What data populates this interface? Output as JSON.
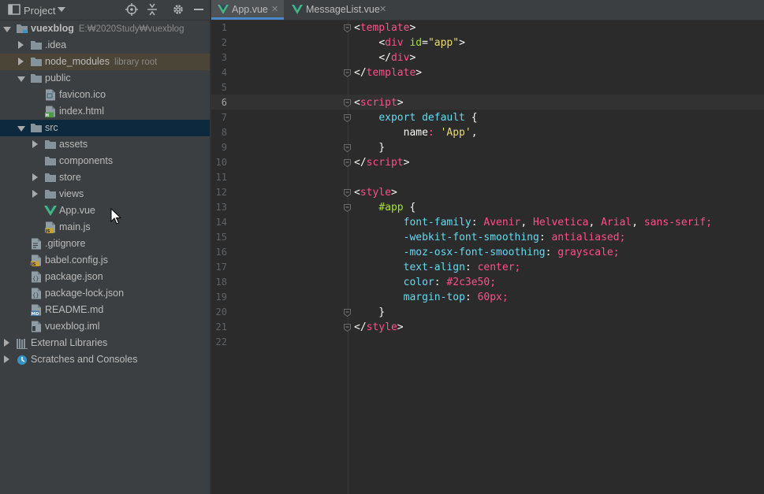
{
  "sidebar": {
    "title": "Project",
    "tree": [
      {
        "label": "vuexblog",
        "hint": "E:₩2020Study₩vuexblog",
        "icon": "module-folder-icon",
        "indent": 0,
        "arrow": "down",
        "bold": true
      },
      {
        "label": ".idea",
        "hint": "",
        "icon": "folder-icon",
        "indent": 1,
        "arrow": "right"
      },
      {
        "label": "node_modules",
        "hint": "library root",
        "icon": "folder-icon",
        "indent": 1,
        "arrow": "right",
        "state": "library"
      },
      {
        "label": "public",
        "hint": "",
        "icon": "folder-icon",
        "indent": 1,
        "arrow": "down"
      },
      {
        "label": "favicon.ico",
        "hint": "",
        "icon": "image-file-icon",
        "indent": 2,
        "arrow": "none"
      },
      {
        "label": "index.html",
        "hint": "",
        "icon": "html-file-icon",
        "indent": 2,
        "arrow": "none"
      },
      {
        "label": "src",
        "hint": "",
        "icon": "folder-icon",
        "indent": 1,
        "arrow": "down",
        "state": "selected"
      },
      {
        "label": "assets",
        "hint": "",
        "icon": "folder-icon",
        "indent": 2,
        "arrow": "right"
      },
      {
        "label": "components",
        "hint": "",
        "icon": "folder-icon",
        "indent": 2,
        "arrow": "none"
      },
      {
        "label": "store",
        "hint": "",
        "icon": "folder-icon",
        "indent": 2,
        "arrow": "right"
      },
      {
        "label": "views",
        "hint": "",
        "icon": "folder-icon",
        "indent": 2,
        "arrow": "right"
      },
      {
        "label": "App.vue",
        "hint": "",
        "icon": "vue-file-icon",
        "indent": 2,
        "arrow": "none"
      },
      {
        "label": "main.js",
        "hint": "",
        "icon": "js-file-icon",
        "indent": 2,
        "arrow": "none"
      },
      {
        "label": ".gitignore",
        "hint": "",
        "icon": "text-file-icon",
        "indent": 1,
        "arrow": "none"
      },
      {
        "label": "babel.config.js",
        "hint": "",
        "icon": "js-file-icon",
        "indent": 1,
        "arrow": "none"
      },
      {
        "label": "package.json",
        "hint": "",
        "icon": "json-file-icon",
        "indent": 1,
        "arrow": "none"
      },
      {
        "label": "package-lock.json",
        "hint": "",
        "icon": "json-file-icon",
        "indent": 1,
        "arrow": "none"
      },
      {
        "label": "README.md",
        "hint": "",
        "icon": "markdown-file-icon",
        "indent": 1,
        "arrow": "none"
      },
      {
        "label": "vuexblog.iml",
        "hint": "",
        "icon": "iml-file-icon",
        "indent": 1,
        "arrow": "none"
      },
      {
        "label": "External Libraries",
        "hint": "",
        "icon": "libraries-icon",
        "indent": 0,
        "arrow": "right"
      },
      {
        "label": "Scratches and Consoles",
        "hint": "",
        "icon": "scratches-icon",
        "indent": 0,
        "arrow": "right"
      }
    ]
  },
  "tabs": [
    {
      "label": "App.vue",
      "active": true
    },
    {
      "label": "MessageList.vue",
      "active": false
    }
  ],
  "editor": {
    "current_line": 6,
    "lines": [
      [
        [
          "tk-br",
          "<"
        ],
        [
          "tk-tag",
          "template"
        ],
        [
          "tk-br",
          ">"
        ]
      ],
      [
        [
          "tk-plain",
          "    "
        ],
        [
          "tk-br",
          "<"
        ],
        [
          "tk-tag",
          "div"
        ],
        [
          "tk-plain",
          " "
        ],
        [
          "tk-attr",
          "id"
        ],
        [
          "tk-br",
          "="
        ],
        [
          "tk-str",
          "\"app\""
        ],
        [
          "tk-br",
          ">"
        ]
      ],
      [
        [
          "tk-plain",
          "    "
        ],
        [
          "tk-br",
          "</"
        ],
        [
          "tk-tag",
          "div"
        ],
        [
          "tk-br",
          ">"
        ]
      ],
      [
        [
          "tk-br",
          "</"
        ],
        [
          "tk-tag",
          "template"
        ],
        [
          "tk-br",
          ">"
        ]
      ],
      [],
      [
        [
          "tk-br",
          "<"
        ],
        [
          "tk-tag",
          "script"
        ],
        [
          "tk-br",
          ">"
        ]
      ],
      [
        [
          "tk-plain",
          "    "
        ],
        [
          "tk-kw",
          "export default"
        ],
        [
          "tk-plain",
          " {"
        ]
      ],
      [
        [
          "tk-plain",
          "        name"
        ],
        [
          "tk-val",
          ":"
        ],
        [
          "tk-plain",
          " "
        ],
        [
          "tk-str",
          "'App'"
        ],
        [
          "tk-plain",
          ","
        ]
      ],
      [
        [
          "tk-plain",
          "    }"
        ]
      ],
      [
        [
          "tk-br",
          "</"
        ],
        [
          "tk-tag",
          "script"
        ],
        [
          "tk-br",
          ">"
        ]
      ],
      [],
      [
        [
          "tk-br",
          "<"
        ],
        [
          "tk-tag",
          "style"
        ],
        [
          "tk-br",
          ">"
        ]
      ],
      [
        [
          "tk-plain",
          "    "
        ],
        [
          "tk-attr",
          "#app"
        ],
        [
          "tk-plain",
          " {"
        ]
      ],
      [
        [
          "tk-plain",
          "        "
        ],
        [
          "tk-prop",
          "font-family"
        ],
        [
          "tk-plain",
          ": "
        ],
        [
          "tk-val",
          "Avenir"
        ],
        [
          "tk-plain",
          ", "
        ],
        [
          "tk-val",
          "Helvetica"
        ],
        [
          "tk-plain",
          ", "
        ],
        [
          "tk-val",
          "Arial"
        ],
        [
          "tk-plain",
          ", "
        ],
        [
          "tk-val",
          "sans-serif"
        ],
        [
          "tk-val",
          ";"
        ]
      ],
      [
        [
          "tk-plain",
          "        "
        ],
        [
          "tk-prop",
          "-webkit-font-smoothing"
        ],
        [
          "tk-plain",
          ": "
        ],
        [
          "tk-val",
          "antialiased"
        ],
        [
          "tk-val",
          ";"
        ]
      ],
      [
        [
          "tk-plain",
          "        "
        ],
        [
          "tk-prop",
          "-moz-osx-font-smoothing"
        ],
        [
          "tk-plain",
          ": "
        ],
        [
          "tk-val",
          "grayscale"
        ],
        [
          "tk-val",
          ";"
        ]
      ],
      [
        [
          "tk-plain",
          "        "
        ],
        [
          "tk-prop",
          "text-align"
        ],
        [
          "tk-plain",
          ": "
        ],
        [
          "tk-val",
          "center"
        ],
        [
          "tk-val",
          ";"
        ]
      ],
      [
        [
          "tk-plain",
          "        "
        ],
        [
          "tk-prop",
          "color"
        ],
        [
          "tk-plain",
          ": "
        ],
        [
          "tk-val",
          "#2c3e50"
        ],
        [
          "tk-val",
          ";"
        ]
      ],
      [
        [
          "tk-plain",
          "        "
        ],
        [
          "tk-prop",
          "margin-top"
        ],
        [
          "tk-plain",
          ": "
        ],
        [
          "tk-val",
          "60px"
        ],
        [
          "tk-val",
          ";"
        ]
      ],
      [
        [
          "tk-plain",
          "    }"
        ]
      ],
      [
        [
          "tk-br",
          "</"
        ],
        [
          "tk-tag",
          "style"
        ],
        [
          "tk-br",
          ">"
        ]
      ],
      []
    ],
    "fold_lines": [
      1,
      4,
      6,
      7,
      9,
      10,
      12,
      13,
      20,
      21
    ]
  },
  "colors": {
    "accent": "#4a88c7",
    "selection": "#0d293e",
    "library_highlight": "#4a4536",
    "vue_green": "#41b883"
  }
}
